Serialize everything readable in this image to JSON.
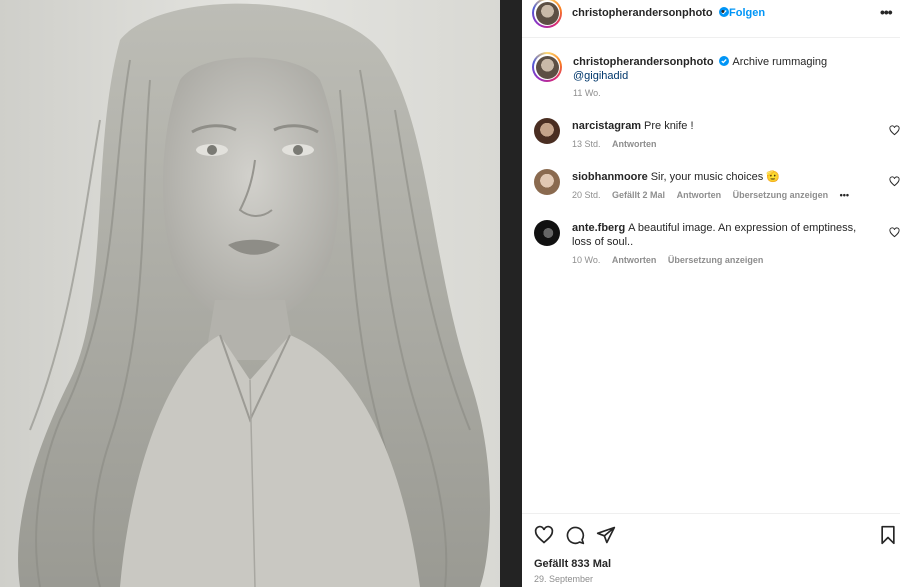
{
  "post": {
    "author": "christopherandersonphoto",
    "follow_label": "Folgen",
    "separator": "•",
    "more_label": "•••",
    "caption_text": "Archive rummaging",
    "caption_mention": "@gigihadid",
    "caption_age": "11 Wo.",
    "likes": "Gefällt 833 Mal",
    "date": "29. September"
  },
  "comments": [
    {
      "user": "narcistagram",
      "text": "Pre knife !",
      "age": "13 Std.",
      "likes": "",
      "reply": "Antworten",
      "translate": "",
      "more": ""
    },
    {
      "user": "siobhanmoore",
      "text": "Sir, your music choices 🫡",
      "age": "20 Std.",
      "likes": "Gefällt 2 Mal",
      "reply": "Antworten",
      "translate": "Übersetzung anzeigen",
      "more": "•••"
    },
    {
      "user": "ante.fberg",
      "text": "A beautiful image. An expression of emptiness, loss of soul..",
      "age": "10 Wo.",
      "likes": "",
      "reply": "Antworten",
      "translate": "Übersetzung anzeigen",
      "more": ""
    }
  ],
  "icons": {
    "like": "heart-icon",
    "comment": "comment-icon",
    "share": "share-icon",
    "save": "bookmark-icon",
    "verified": "verified-badge-icon"
  },
  "colors": {
    "link": "#0095f6",
    "mention": "#00376b",
    "verified": "#0095f6",
    "muted": "#8e8e8e"
  }
}
